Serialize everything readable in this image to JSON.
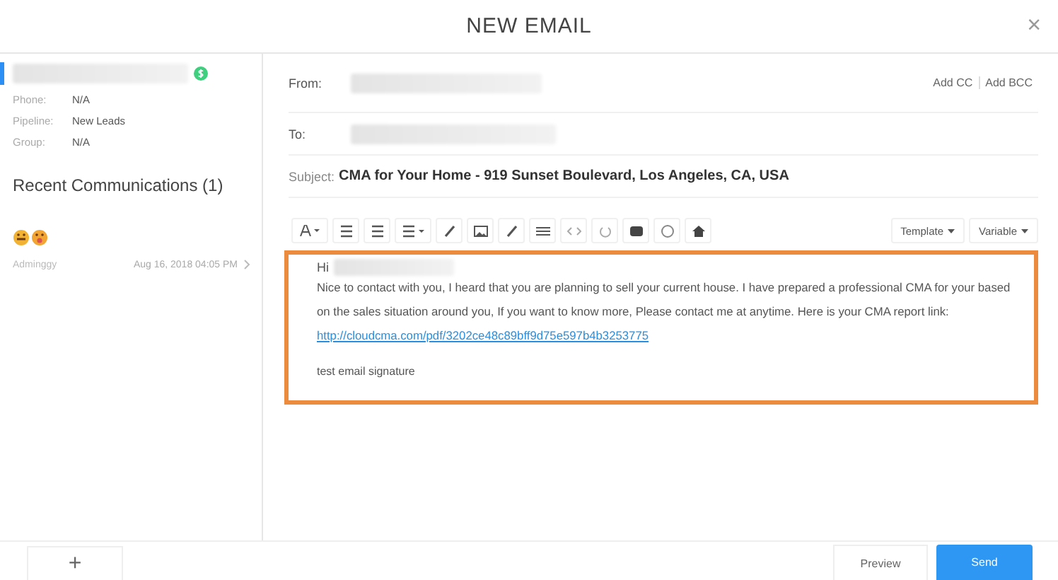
{
  "window": {
    "title": "NEW EMAIL",
    "close": "×"
  },
  "contact": {
    "fields": [
      {
        "label": "Phone:",
        "value": "N/A"
      },
      {
        "label": "Pipeline:",
        "value": "New Leads"
      },
      {
        "label": "Group:",
        "value": "N/A"
      }
    ],
    "recent_title": "Recent Communications (1)",
    "communications": [
      {
        "author": "Adminggy",
        "date": "Aug 16, 2018 04:05 PM"
      }
    ]
  },
  "email": {
    "from_label": "From:",
    "add_cc": "Add CC",
    "add_bcc": "Add BCC",
    "to_label": "To:",
    "subject_label": "Subject:",
    "subject": "CMA for Your Home - 919 Sunset Boulevard, Los Angeles, CA, USA",
    "toolbar_dropdowns": [
      "Template",
      "Variable"
    ],
    "greeting": "Hi",
    "body": "Nice to contact with you, I heard that you are planning to sell your current house. I have prepared a professional CMA for your based on the sales situation around you, If you want to know more, Please contact me at anytime. Here is your CMA report link:",
    "link": "http://cloudcma.com/pdf/3202ce48c89bff9d75e597b4b3253775",
    "signature": "test email signature"
  },
  "footer": {
    "add": "+",
    "preview": "Preview",
    "send": "Send"
  }
}
